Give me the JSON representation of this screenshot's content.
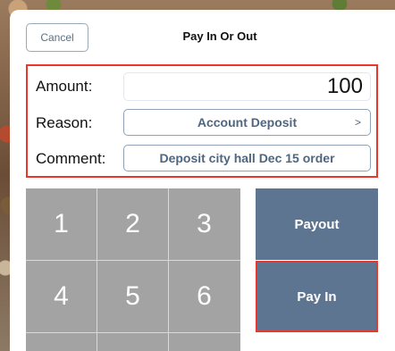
{
  "header": {
    "cancel_label": "Cancel",
    "title": "Pay In Or Out"
  },
  "form": {
    "amount_label": "Amount:",
    "amount_value": "100",
    "reason_label": "Reason:",
    "reason_value": "Account Deposit",
    "reason_chevron": ">",
    "comment_label": "Comment:",
    "comment_value": "Deposit city hall Dec 15 order"
  },
  "keypad": {
    "keys": [
      "1",
      "2",
      "3",
      "4",
      "5",
      "6"
    ]
  },
  "actions": {
    "payout_label": "Payout",
    "payin_label": "Pay In"
  },
  "colors": {
    "accent": "#5d7590",
    "highlight": "#e8382b",
    "keypad": "#a3a3a3"
  }
}
